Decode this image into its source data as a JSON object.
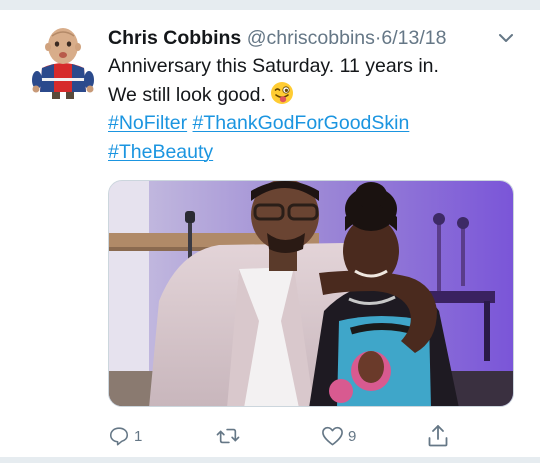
{
  "tweet": {
    "author": {
      "display_name": "Chris Cobbins",
      "handle": "@chriscobbins",
      "separator": "·",
      "date": "6/13/18"
    },
    "text_lines": [
      "Anniversary this Saturday. 11 years in.",
      "We still look good."
    ],
    "emoji": "winking-face-with-tongue",
    "hashtags": [
      "#NoFilter",
      "#ThankGodForGoodSkin",
      "#TheBeauty"
    ],
    "actions": {
      "reply_count": "1",
      "retweet_count": "",
      "like_count": "9"
    }
  },
  "colors": {
    "link": "#1b95e0",
    "secondary_text": "#657786",
    "primary_text": "#14171a",
    "photo_purple": "#8f6fe0"
  },
  "icons": {
    "menu": "chevron-down-icon",
    "reply": "reply-icon",
    "retweet": "retweet-icon",
    "like": "heart-icon",
    "share": "share-icon"
  }
}
